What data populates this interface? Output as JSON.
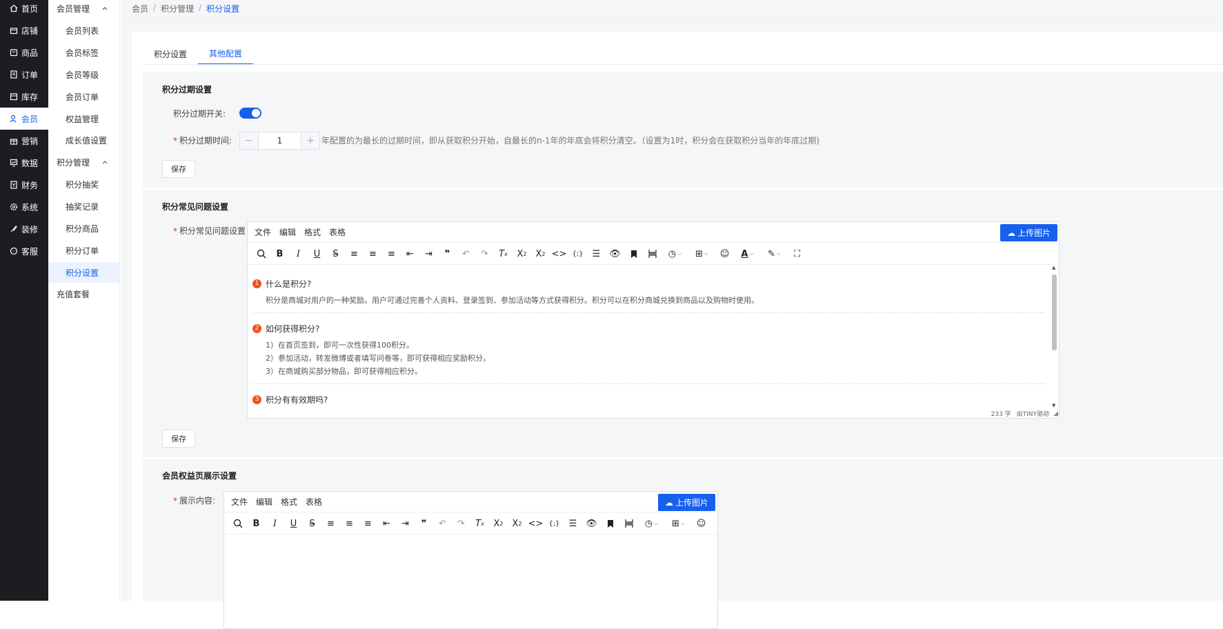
{
  "nav": [
    {
      "label": "首页",
      "icon": "home-icon"
    },
    {
      "label": "店铺",
      "icon": "shop-icon"
    },
    {
      "label": "商品",
      "icon": "goods-icon"
    },
    {
      "label": "订单",
      "icon": "order-icon"
    },
    {
      "label": "库存",
      "icon": "stock-icon"
    },
    {
      "label": "会员",
      "icon": "member-icon"
    },
    {
      "label": "营销",
      "icon": "gift-icon"
    },
    {
      "label": "数据",
      "icon": "chart-icon"
    },
    {
      "label": "财务",
      "icon": "finance-icon"
    },
    {
      "label": "系统",
      "icon": "gear-icon"
    },
    {
      "label": "装修",
      "icon": "brush-icon"
    },
    {
      "label": "客服",
      "icon": "chat-icon"
    }
  ],
  "submenu": {
    "group1": "会员管理",
    "group1_items": [
      "会员列表",
      "会员标签",
      "会员等级",
      "会员订单",
      "权益管理",
      "成长值设置"
    ],
    "group2": "积分管理",
    "group2_items": [
      "积分抽奖",
      "抽奖记录",
      "积分商品",
      "积分订单",
      "积分设置"
    ],
    "last": "充值套餐"
  },
  "breadcrumb": [
    "会员",
    "积分管理",
    "积分设置"
  ],
  "tabs": [
    "积分设置",
    "其他配置"
  ],
  "expiry": {
    "title": "积分过期设置",
    "switch_label": "积分过期开关:",
    "switch_on": true,
    "time_label": "积分过期时间:",
    "value": "1",
    "hint": "年配置的为最长的过期时间，即从获取积分开始，自最长的n-1年的年底会将积分清空。（设置为1时，积分会在获取积分当年的年底过期)",
    "save": "保存"
  },
  "faq": {
    "title": "积分常见问题设置",
    "label": "积分常见问题设置",
    "menu": [
      "文件",
      "编辑",
      "格式",
      "表格"
    ],
    "upload": "上传图片",
    "items": [
      {
        "n": "1",
        "q": "什么是积分?",
        "a": [
          "积分是商城对用户的一种奖励。用户可通过完善个人资料、登录签到、参加活动等方式获得积分。积分可以在积分商城兑换到商品以及购物时使用。"
        ]
      },
      {
        "n": "2",
        "q": "如何获得积分?",
        "a": [
          "1）在首页签到，即可一次性获得100积分。",
          "2）参加活动，转发微博或者填写问卷等，即可获得相应奖励积分。",
          "3）在商城购买部分物品，即可获得相应积分。"
        ]
      },
      {
        "n": "3",
        "q": "积分有有效期吗?",
        "a": []
      }
    ],
    "wordcount": "233 字",
    "powered": "由TINY驱动",
    "save": "保存"
  },
  "rights": {
    "title": "会员权益页展示设置",
    "label": "展示内容:",
    "menu": [
      "文件",
      "编辑",
      "格式",
      "表格"
    ],
    "upload": "上传图片"
  },
  "colors": {
    "accent": "#1660ed",
    "sidebar": "#1b1d20",
    "badge": "#f0501c"
  }
}
